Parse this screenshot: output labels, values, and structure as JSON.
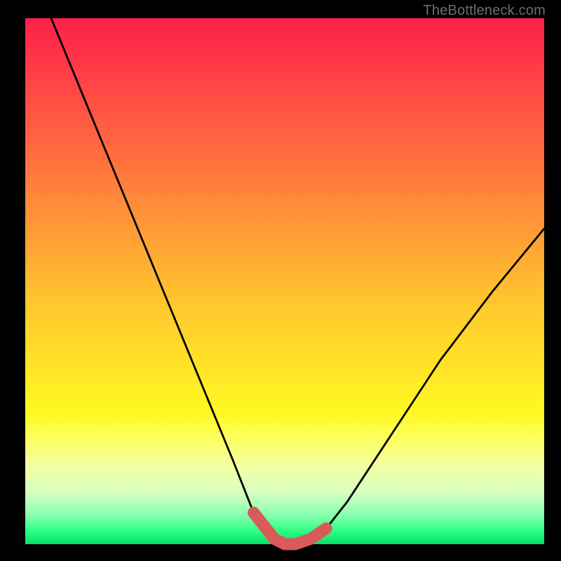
{
  "watermark": "TheBottleneck.com",
  "chart_data": {
    "type": "line",
    "title": "",
    "xlabel": "",
    "ylabel": "",
    "xlim": [
      0,
      100
    ],
    "ylim": [
      0,
      100
    ],
    "grid": false,
    "legend": false,
    "background_gradient": {
      "orientation": "vertical",
      "stops": [
        {
          "pos": 0.0,
          "color": "#ff1f49"
        },
        {
          "pos": 0.25,
          "color": "#ff6a3f"
        },
        {
          "pos": 0.55,
          "color": "#ffc92e"
        },
        {
          "pos": 0.75,
          "color": "#fff823"
        },
        {
          "pos": 0.9,
          "color": "#d9ffc0"
        },
        {
          "pos": 1.0,
          "color": "#05e06c"
        }
      ]
    },
    "series": [
      {
        "name": "bottleneck-curve",
        "color": "#000000",
        "x": [
          5,
          10,
          15,
          20,
          25,
          30,
          35,
          40,
          44,
          48,
          50,
          52,
          55,
          58,
          62,
          70,
          80,
          90,
          100
        ],
        "y": [
          100,
          88,
          76,
          64,
          52,
          40,
          28,
          16,
          6,
          1,
          0,
          0,
          1,
          3,
          8,
          20,
          35,
          48,
          60
        ]
      },
      {
        "name": "optimal-range-highlight",
        "color": "#d85a5a",
        "x": [
          44,
          48,
          50,
          52,
          55,
          58
        ],
        "y": [
          6,
          1,
          0,
          0,
          1,
          3
        ]
      }
    ],
    "annotations": []
  }
}
